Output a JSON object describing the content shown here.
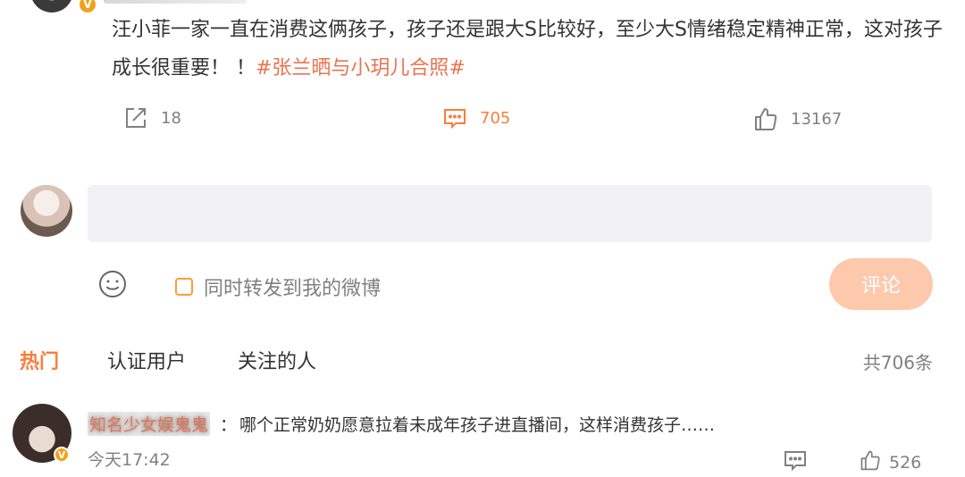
{
  "post": {
    "text": "汪小菲一家一直在消费这俩孩子，孩子还是跟大S比较好，至少大S情绪稳定精神正常，这对孩子成长很重要！ ！",
    "hashtag": "#张兰晒与小玥儿合照#",
    "badge": "V"
  },
  "actions": {
    "forward_count": "18",
    "comment_count": "705",
    "like_count": "13167"
  },
  "composer": {
    "input_value": "",
    "forward_label": "同时转发到我的微博",
    "submit_label": "评论"
  },
  "comments_section": {
    "tabs": [
      "热门",
      "认证用户",
      "关注的人"
    ],
    "total": "共706条",
    "items": [
      {
        "username": "知名少女娱鬼鬼",
        "separator": "：",
        "text": "哪个正常奶奶愿意拉着未成年孩子进直播间，这样消费孩子……",
        "time": "今天17:42",
        "likes": "526",
        "badge": "V"
      }
    ]
  },
  "colors": {
    "accent": "#fa7d3c",
    "hashtag": "#eb7350",
    "muted": "#808080",
    "submit_disabled": "#fdc9ad"
  }
}
